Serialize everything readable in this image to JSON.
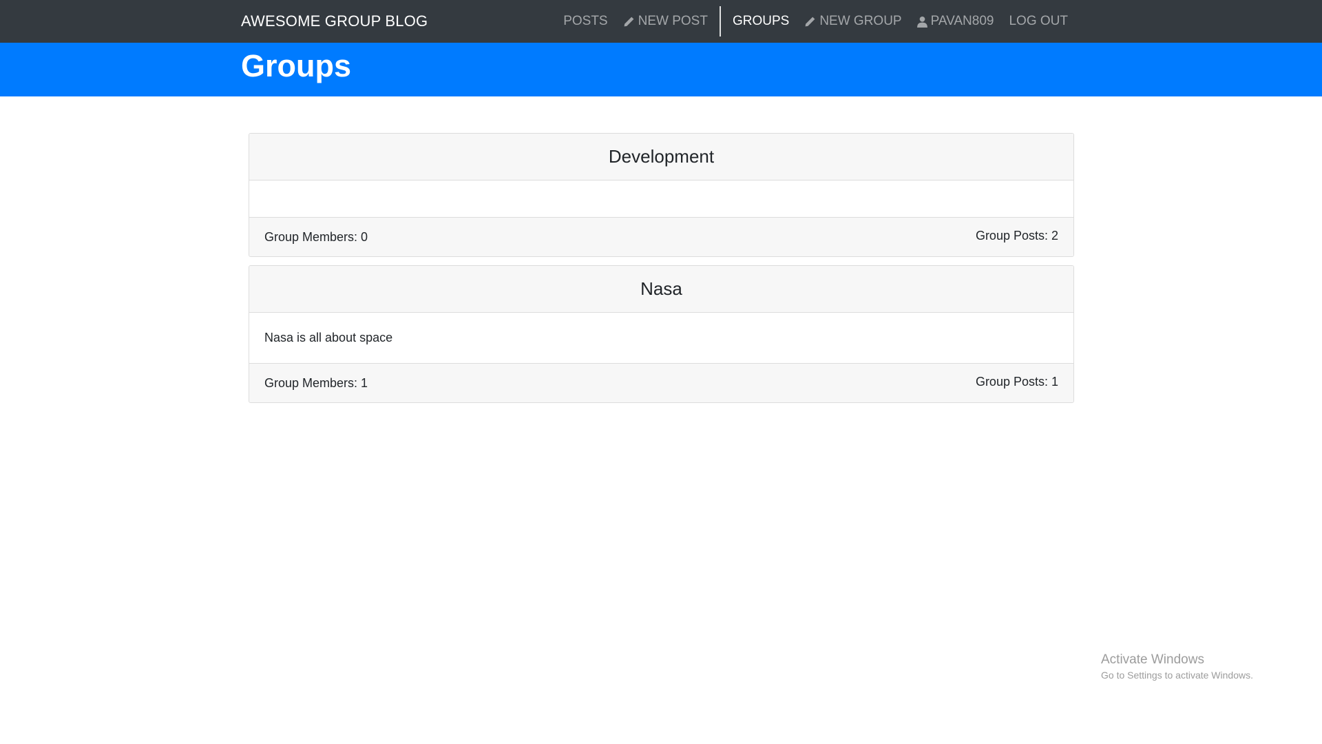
{
  "navbar": {
    "brand": "AWESOME GROUP BLOG",
    "links": {
      "posts": "POSTS",
      "new_post": "NEW POST",
      "groups": "GROUPS",
      "new_group": "NEW GROUP",
      "user": "PAVAN809",
      "logout": "LOG OUT"
    },
    "icons": {
      "new_post": "pencil-icon",
      "new_group": "pencil-icon",
      "user": "user-icon"
    },
    "active": "groups"
  },
  "header": {
    "title": "Groups",
    "background": "#007bff"
  },
  "groups": [
    {
      "name": "Development",
      "description": "",
      "members_label": "Group Members: 0",
      "posts_label": "Group Posts: 2"
    },
    {
      "name": "Nasa",
      "description": "Nasa is all about space",
      "members_label": "Group Members: 1",
      "posts_label": "Group Posts: 1"
    }
  ],
  "watermark": {
    "title": "Activate Windows",
    "subtitle": "Go to Settings to activate Windows."
  },
  "colors": {
    "navbar": "#343a40",
    "accent": "#007bff"
  }
}
